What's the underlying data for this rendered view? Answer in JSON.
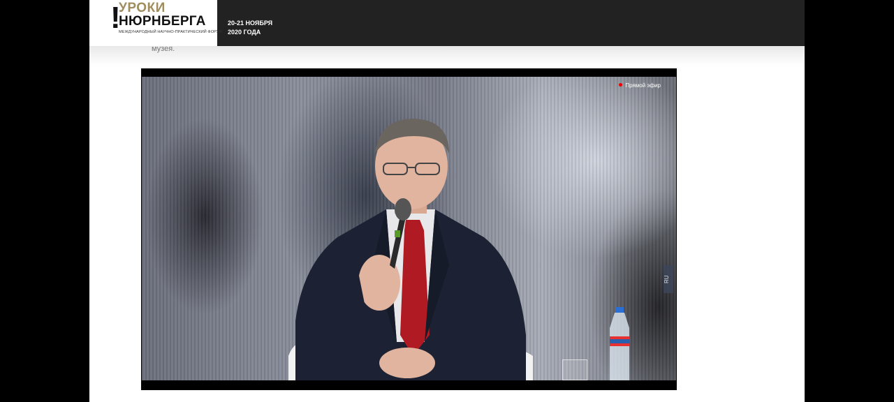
{
  "header": {
    "logo_bang": "!",
    "logo_line1": "УРОКИ",
    "logo_line2": "НЮРНБЕРГА",
    "logo_subtitle": "МЕЖДУНАРОДНЫЙ НАУЧНО-ПРАКТИЧЕСКИЙ ФОРУМ",
    "date_line1": "20-21 НОЯБРЯ",
    "date_line2": "2020 ГОДА"
  },
  "article": {
    "snippet": "музея."
  },
  "video": {
    "live_label": "Прямой эфир",
    "lang_label": "RU"
  },
  "colors": {
    "logo_accent": "#a08c5c",
    "header_bg": "#222222",
    "live_dot": "#e00000"
  }
}
